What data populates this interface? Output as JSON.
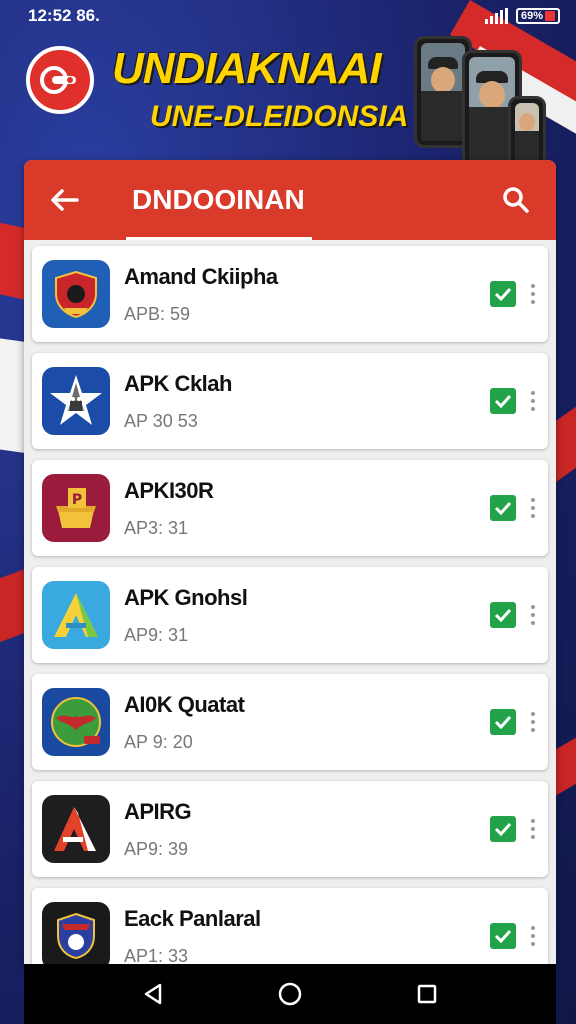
{
  "status_bar": {
    "time": "12:52 86.",
    "battery_label": "69%"
  },
  "banner": {
    "title": "UNDIAKNAAI",
    "subtitle": "UNE-DLEIDONSIA"
  },
  "app_bar": {
    "title": "DNDOOINAN"
  },
  "apps": [
    {
      "name": "Amand Ckiipha",
      "sub": "APB: 59",
      "icon": "shield-crest-icon",
      "colors": [
        "#1f5fb5",
        "#c8262b"
      ]
    },
    {
      "name": "APK Cklah",
      "sub": "AP 30 53",
      "icon": "rocket-star-icon",
      "colors": [
        "#1b4ca8",
        "#ffffff"
      ]
    },
    {
      "name": "APKI30R",
      "sub": "AP3: 31",
      "icon": "golden-box-icon",
      "colors": [
        "#9a1b3c",
        "#f2c23a"
      ]
    },
    {
      "name": "APK Gnohsl",
      "sub": "AP9: 31",
      "icon": "letter-a-triangle-icon",
      "colors": [
        "#3aa9e0",
        "#f5d23a"
      ]
    },
    {
      "name": "AI0K Quatat",
      "sub": "AP 9: 20",
      "icon": "eagle-emblem-icon",
      "colors": [
        "#1a4aa0",
        "#3c9c3c"
      ]
    },
    {
      "name": "APIRG",
      "sub": "AP9: 39",
      "icon": "red-letter-a-icon",
      "colors": [
        "#1e1e1e",
        "#e3422a"
      ]
    },
    {
      "name": "Eack Panlaral",
      "sub": "AP1: 33",
      "icon": "dark-shield-icon",
      "colors": [
        "#1a1a1a",
        "#c42a2a"
      ]
    }
  ],
  "colors": {
    "app_bar": "#d93a2a",
    "check": "#22a34a",
    "background": "#1f2a6e"
  }
}
